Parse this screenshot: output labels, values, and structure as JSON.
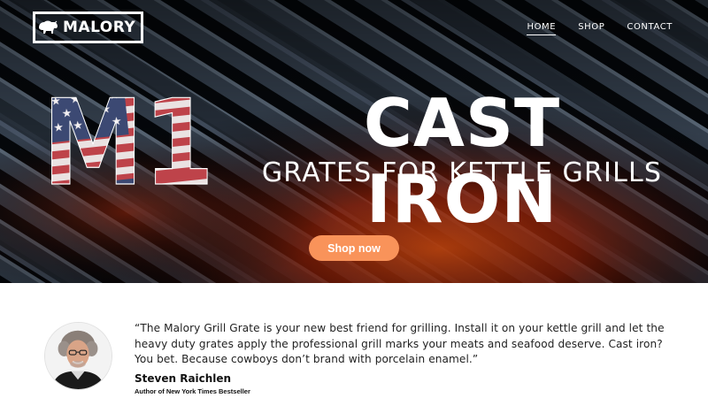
{
  "brand": {
    "name": "MALORY",
    "icon": "bison-icon"
  },
  "nav": {
    "items": [
      {
        "label": "HOME",
        "active": true
      },
      {
        "label": "SHOP",
        "active": false
      },
      {
        "label": "CONTACT",
        "active": false
      }
    ]
  },
  "hero": {
    "model": "M1",
    "headline": "CAST IRON",
    "subheadline": "GRATES FOR KETTLE GRILLS",
    "cta_label": "Shop now"
  },
  "testimonial": {
    "quote": "“The Malory Grill Grate is your new best friend for grilling. Install it on your kettle grill and let the heavy duty grates apply the professional grill marks your meats and seafood deserve. Cast iron? You bet. Because cowboys don’t brand with porcelain enamel.”",
    "author_name": "Steven Raichlen",
    "author_title": "Author of New York Times Bestseller"
  },
  "colors": {
    "cta": "#f9935a",
    "hero_dark": "#0a0f16",
    "flag_red": "#b8333b",
    "flag_blue": "#2b3a67"
  }
}
